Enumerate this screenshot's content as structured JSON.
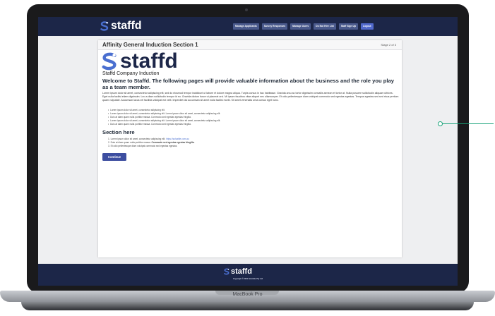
{
  "device": {
    "model_label": "MacBook Pro"
  },
  "app": {
    "brand": "staffd",
    "nav": [
      {
        "label": "Manage Applicants"
      },
      {
        "label": "Survey Responses"
      },
      {
        "label": "Manage Users"
      },
      {
        "label": "Do Not Hire List"
      },
      {
        "label": "Staff Sign Up"
      },
      {
        "label": "Logout"
      }
    ]
  },
  "card": {
    "title": "Affinity General Induction Section 1",
    "stage": "Stage 2 of 3",
    "company": "Staffd Company Induction",
    "welcome": "Welcome to Staffd. The following pages will provide valuable information about the business and the role you play as a team member.",
    "intro": "Lorem ipsum dolor sit amet, consectetur adipiscing elit, sed do eiusmod tempor incididunt ut labore et dolore magna aliqua. Turpis cursus in hac habitasse. Gravida arcu ac tortor dignissim convallis aenean et tortor at. Nulla posuere sollicitudin aliquam ultrices. Eget nulla facilisi etiam dignissim. Leo a diam sollicitudin tempor id eu. Gravida dictum fusce ut placerat orci. Mi ipsum faucibus vitae aliquet nec ullamcorper. Et odio pellentesque diam volutpat commodo sed egestas egestas. Tempus egestas sed sed risus pretium quam vulputate. Accumsan lacus vel facilisis volutpat est velit. Imperdiet dui accumsan sit amet nulla facilisi morbi. Sit amet venenatis urna cursus eget nunc.",
    "bullets": [
      "Lorem ipsum dolor sit amet, consectetur adipiscing elit.",
      "Lorem ipsum dolor sit amet, consectetur adipiscing elit. Lorem ipsum dolor sit amet, consectetur adipiscing elit.",
      "Duis at diam quam nulla porttitor massa. Commodo sed egestas egestas fringilla.",
      "Lorem ipsum dolor sit amet, consectetur adipiscing elit. Lorem ipsum dolor sit amet, consectetur adipiscing elit.",
      "Duis at diam quam nulla porttitor massa. Commodo sed egestas egestas fringilla."
    ],
    "section_heading": "Section here",
    "numbered": [
      {
        "num": "1.",
        "text": "Lorem ipsum dolor sit amet, consectetur adipiscing elit.",
        "link": "https://solvable.com.au"
      },
      {
        "num": "2.",
        "text": "Duis at diam quam nulla porttitor massa.",
        "bold": "Commodo sed egestas egestas fringilla."
      },
      {
        "num": "3.",
        "text": "Et odio pellentesque diam volutpat commodo sed egestas egestas."
      }
    ],
    "continue_label": "Continue"
  },
  "footer": {
    "brand": "staffd",
    "copyright": "Copyright © 2021 Solvable Pty Ltd"
  },
  "colors": {
    "navy": "#1c2648",
    "accent": "#5169cc",
    "button": "#3d4ea0",
    "logo_blue": "#4a6fd0",
    "callout": "#1aa37a"
  }
}
